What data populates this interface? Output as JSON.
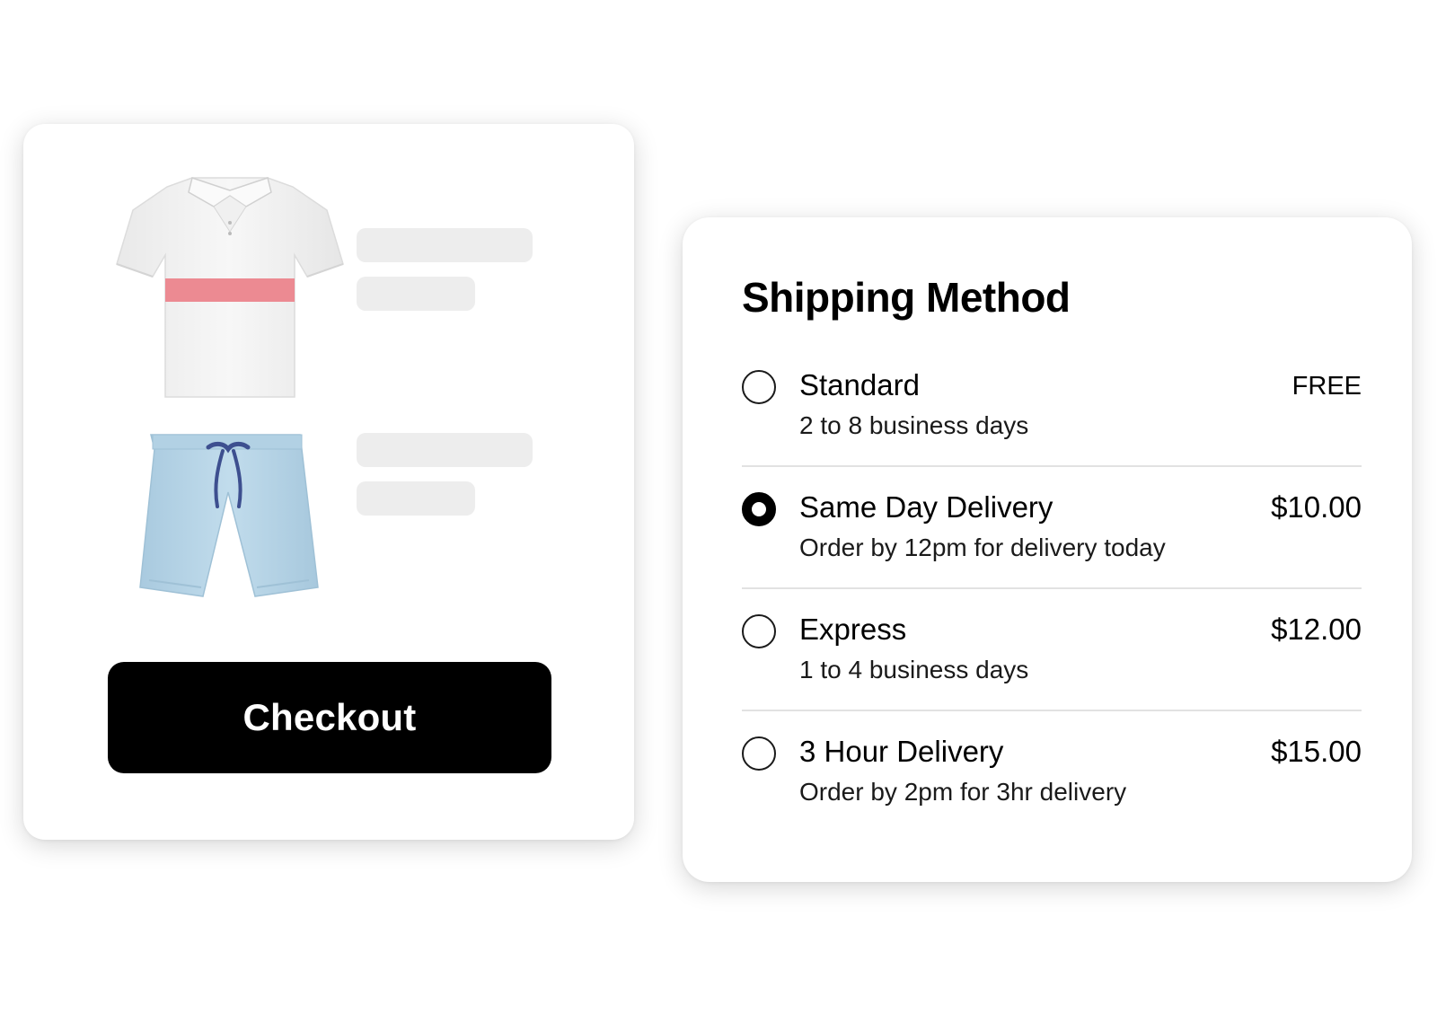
{
  "cart": {
    "items": [
      {
        "name": "polo-shirt",
        "icon": "polo-shirt-image"
      },
      {
        "name": "shorts",
        "icon": "shorts-image"
      }
    ],
    "checkout_label": "Checkout"
  },
  "shipping": {
    "title": "Shipping Method",
    "options": [
      {
        "name": "Standard",
        "description": "2 to 8 business days",
        "price": "FREE",
        "selected": false
      },
      {
        "name": "Same Day Delivery",
        "description": "Order by 12pm for delivery today",
        "price": "$10.00",
        "selected": true
      },
      {
        "name": "Express",
        "description": "1 to 4 business days",
        "price": "$12.00",
        "selected": false
      },
      {
        "name": "3 Hour Delivery",
        "description": "Order by 2pm for 3hr delivery",
        "price": "$15.00",
        "selected": false
      }
    ]
  },
  "colors": {
    "shirt": "#f4f4f4",
    "shirt_stripe": "#ec8a92",
    "shorts": "#b7d5e6",
    "drawstring": "#3d4f8f",
    "button": "#000000"
  }
}
